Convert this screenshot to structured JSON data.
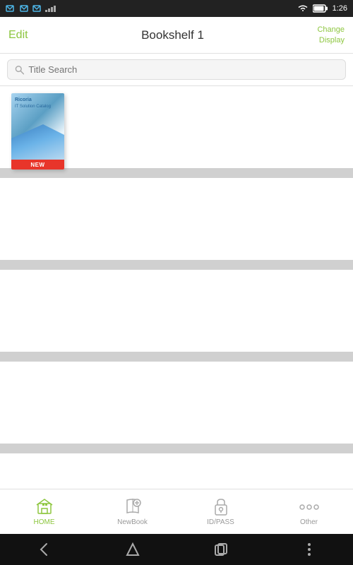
{
  "status_bar": {
    "time": "1:26",
    "icons": [
      "notification",
      "wifi",
      "battery"
    ]
  },
  "top_bar": {
    "edit_label": "Edit",
    "title": "Bookshelf 1",
    "change_display_line1": "Change",
    "change_display_line2": "Display"
  },
  "search": {
    "placeholder": "Title Search"
  },
  "book": {
    "logo": "Ricoria",
    "subtitle": "IT Solution Catalog",
    "new_badge": "NEW"
  },
  "bottom_nav": {
    "items": [
      {
        "id": "home",
        "label": "HOME",
        "active": true
      },
      {
        "id": "newbook",
        "label": "NewBook",
        "active": false
      },
      {
        "id": "idpass",
        "label": "ID/PASS",
        "active": false
      },
      {
        "id": "other",
        "label": "Other",
        "active": false
      }
    ]
  }
}
